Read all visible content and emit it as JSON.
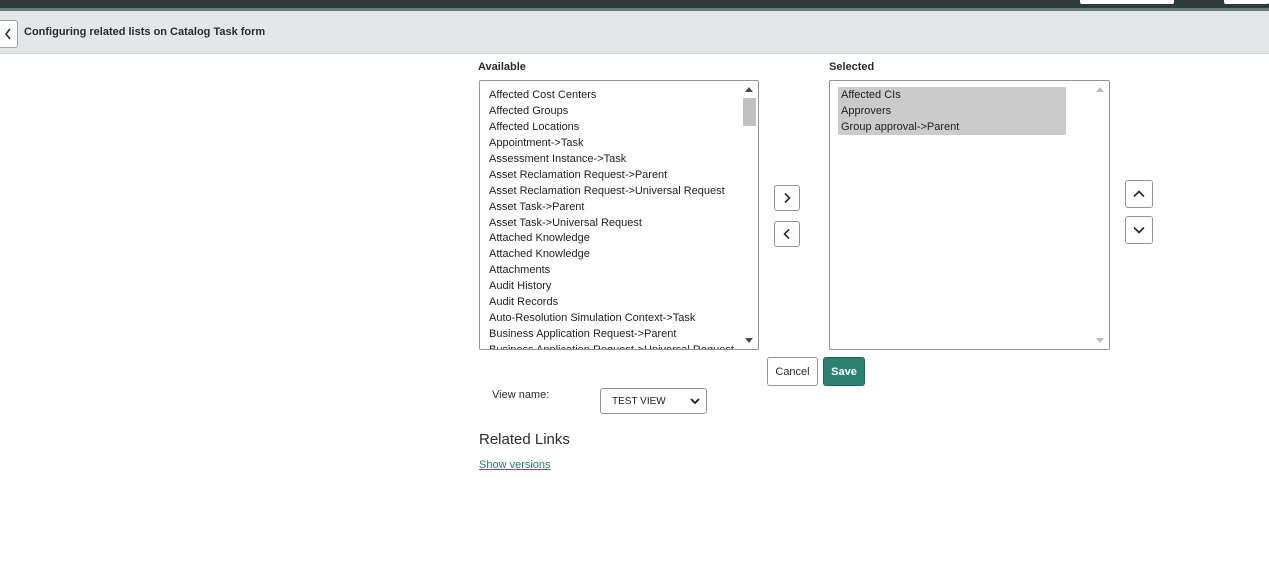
{
  "header": {
    "title": "Configuring related lists on Catalog Task form"
  },
  "available": {
    "label": "Available",
    "items": [
      "Affected Cost Centers",
      "Affected Groups",
      "Affected Locations",
      "Appointment->Task",
      "Assessment Instance->Task",
      "Asset Reclamation Request->Parent",
      "Asset Reclamation Request->Universal Request",
      "Asset Task->Parent",
      "Asset Task->Universal Request",
      "Attached Knowledge",
      "Attached Knowledge",
      "Attachments",
      "Audit History",
      "Audit Records",
      "Auto-Resolution Simulation Context->Task",
      "Business Application Request->Parent",
      "Business Application Request->Universal Request"
    ]
  },
  "selected": {
    "label": "Selected",
    "items": [
      "Affected CIs",
      "Approvers",
      "Group approval->Parent"
    ]
  },
  "actions": {
    "cancel": "Cancel",
    "save": "Save"
  },
  "view": {
    "label": "View name:",
    "value": "TEST VIEW"
  },
  "related_links": {
    "title": "Related Links",
    "show_versions": "Show versions"
  }
}
